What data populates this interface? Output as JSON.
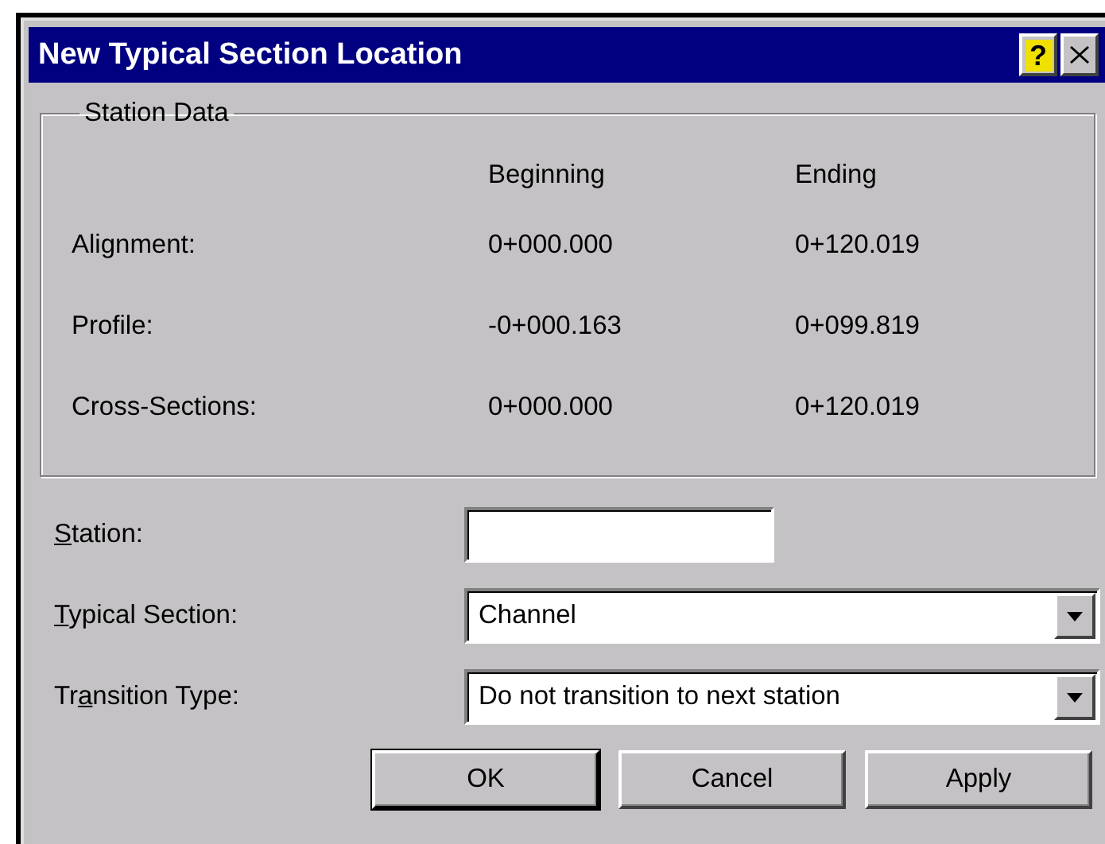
{
  "window": {
    "title": "New Typical Section Location",
    "help_button": "?"
  },
  "station_data": {
    "title": "Station Data",
    "columns": [
      "Beginning",
      "Ending"
    ],
    "rows": [
      {
        "label": "Alignment:",
        "beginning": "0+000.000",
        "ending": "0+120.019"
      },
      {
        "label": "Profile:",
        "beginning": "-0+000.163",
        "ending": "0+099.819"
      },
      {
        "label": "Cross-Sections:",
        "beginning": "0+000.000",
        "ending": "0+120.019"
      }
    ]
  },
  "fields": [
    {
      "kind": "text",
      "label": [
        {
          "text": "S",
          "underlined": true
        },
        {
          "text": "tation:",
          "underlined": false
        }
      ]
    },
    {
      "kind": "combo",
      "label": [
        {
          "text": "T",
          "underlined": true
        },
        {
          "text": "ypical Section:",
          "underlined": false
        }
      ],
      "value": "Channel"
    },
    {
      "kind": "combo",
      "label": [
        {
          "text": "Tr",
          "underlined": false
        },
        {
          "text": "a",
          "underlined": true
        },
        {
          "text": "nsition Type:",
          "underlined": false
        }
      ],
      "value": "Do not transition to next station"
    }
  ],
  "buttons": [
    {
      "label": "OK",
      "default": true
    },
    {
      "label": "Cancel",
      "default": false
    },
    {
      "label": "Apply",
      "default": false
    }
  ]
}
